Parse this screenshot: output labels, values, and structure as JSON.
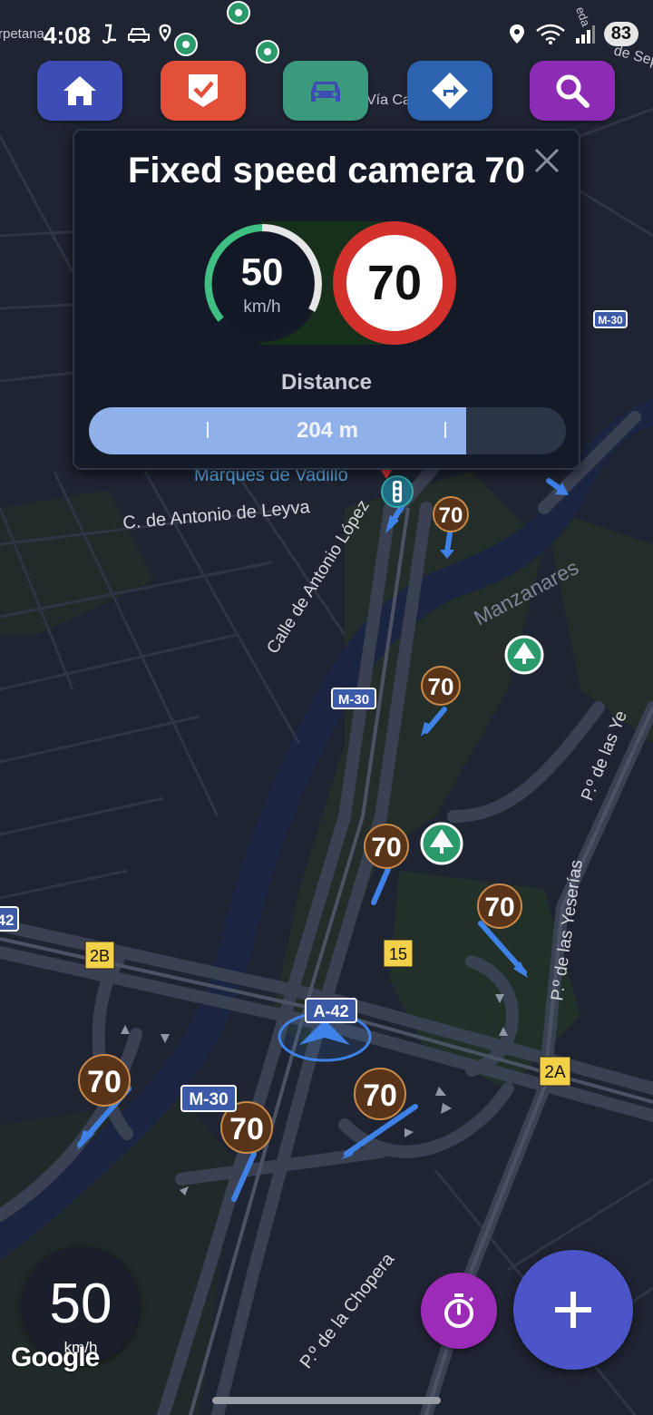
{
  "status_bar": {
    "time": "4:08",
    "battery": "83"
  },
  "map_labels": {
    "street_cut_top_left": "rpetana",
    "street_cut_top_right": "de Sep",
    "street_cut_via": "Vía Car",
    "marques": "Marques de Vadillo",
    "antonio_leyva": "C. de Antonio de Leyva",
    "antonio_lopez": "Calle de Antonio López",
    "manzanares": "Manzanares",
    "yeserias_1": "P.º de las Yeserías",
    "yeserias_2": "P.º de las Ye",
    "chopera": "P.º de la Chopera",
    "edge_top_right": "eda"
  },
  "road_badges": {
    "m30_right": "M-30",
    "m30_center": "M-30",
    "m30_bottom": "M-30",
    "a42": "A-42",
    "a42_left": "42"
  },
  "exit_badges": {
    "exit_2b": "2B",
    "exit_15": "15",
    "exit_2a": "2A"
  },
  "speed_markers": {
    "m1": "70",
    "m2": "70",
    "m3": "70",
    "m4": "70",
    "m5": "70",
    "m6": "70",
    "m7": "70"
  },
  "toolbar": {
    "home_color": "#3d4db5",
    "check_color": "#e3503a",
    "car_color": "#3b9a7e",
    "directions_color": "#2d62b0",
    "search_color": "#8d2bb5"
  },
  "alert": {
    "title": "Fixed speed camera 70",
    "current_speed": "50",
    "speed_unit": "km/h",
    "limit": "70",
    "distance_label": "Distance",
    "distance_value": "204 m",
    "distance_progress": 0.79
  },
  "speedometer": {
    "value": "50",
    "unit": "km/h"
  },
  "google_logo": "Google",
  "colors": {
    "accent_blue": "#4b55c8",
    "timer_purple": "#9c2bb7",
    "sign_red": "#d3312c",
    "marker_brown": "#5a3418",
    "route_blue": "#3e82e8"
  }
}
